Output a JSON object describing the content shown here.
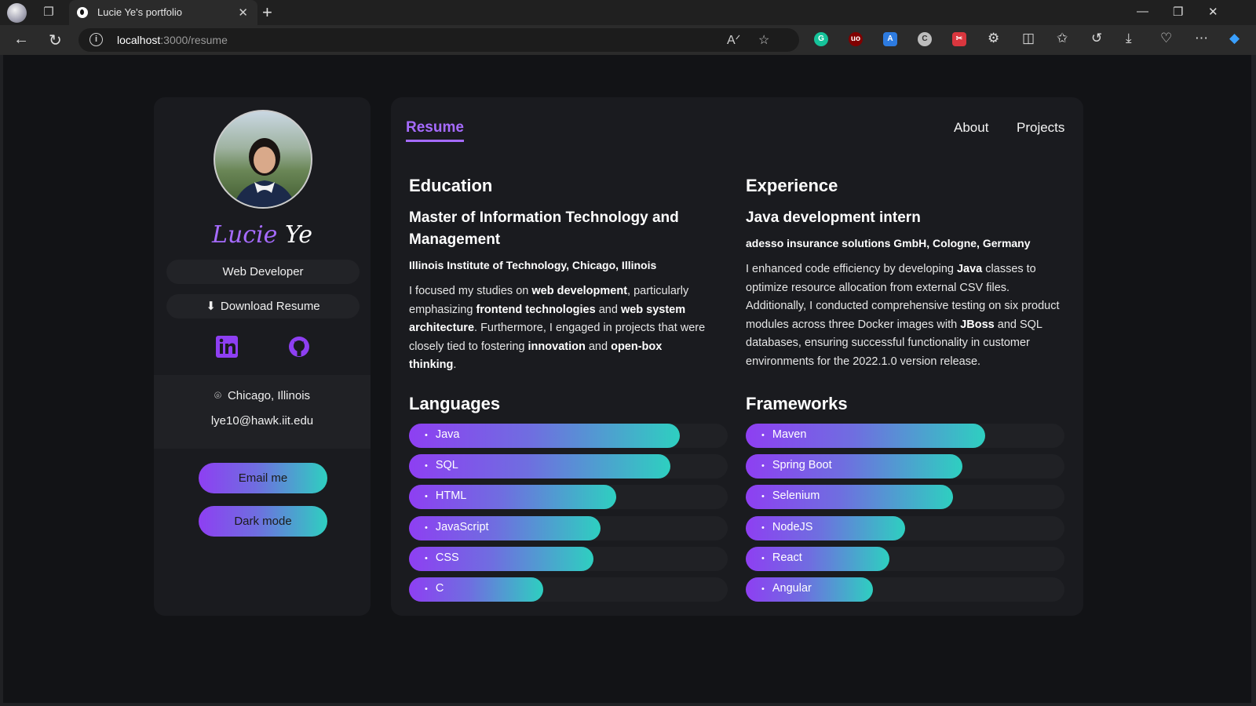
{
  "browser": {
    "tab_title": "Lucie Ye's portfolio",
    "url_host": "localhost",
    "url_path": ":3000/resume",
    "extensions": [
      {
        "name": "grammarly-icon",
        "color": "#15c39a",
        "glyph": "G"
      },
      {
        "name": "ublock-icon",
        "color": "#800000",
        "glyph": "uo"
      },
      {
        "name": "translate-icon",
        "color": "#2d7be0",
        "glyph": "A"
      },
      {
        "name": "extension-c-icon",
        "color": "#bdbdbd",
        "glyph": "C"
      },
      {
        "name": "extension-red-icon",
        "color": "#d9363e",
        "glyph": "✂"
      }
    ]
  },
  "sidebar": {
    "first_name": "Lucie",
    "last_name": "Ye",
    "role": "Web Developer",
    "download_label": "Download Resume",
    "location": "Chicago, Illinois",
    "email": "lye10@hawk.iit.edu",
    "email_button": "Email me",
    "dark_mode_button": "Dark mode"
  },
  "nav": {
    "resume": "Resume",
    "about": "About",
    "projects": "Projects"
  },
  "education": {
    "heading": "Education",
    "degree": "Master of Information Technology and Management",
    "school": "Illinois Institute of Technology, Chicago, Illinois"
  },
  "experience": {
    "heading": "Experience",
    "title": "Java development intern",
    "company": "adesso insurance solutions GmbH, Cologne, Germany"
  },
  "languages": {
    "heading": "Languages",
    "items": [
      {
        "label": "Java",
        "level": 85
      },
      {
        "label": "SQL",
        "level": 82
      },
      {
        "label": "HTML",
        "level": 65
      },
      {
        "label": "JavaScript",
        "level": 60
      },
      {
        "label": "CSS",
        "level": 58
      },
      {
        "label": "C",
        "level": 42
      }
    ]
  },
  "frameworks": {
    "heading": "Frameworks",
    "items": [
      {
        "label": "Maven",
        "level": 75
      },
      {
        "label": "Spring Boot",
        "level": 68
      },
      {
        "label": "Selenium",
        "level": 65
      },
      {
        "label": "NodeJS",
        "level": 50
      },
      {
        "label": "React",
        "level": 45
      },
      {
        "label": "Angular",
        "level": 40
      }
    ]
  }
}
